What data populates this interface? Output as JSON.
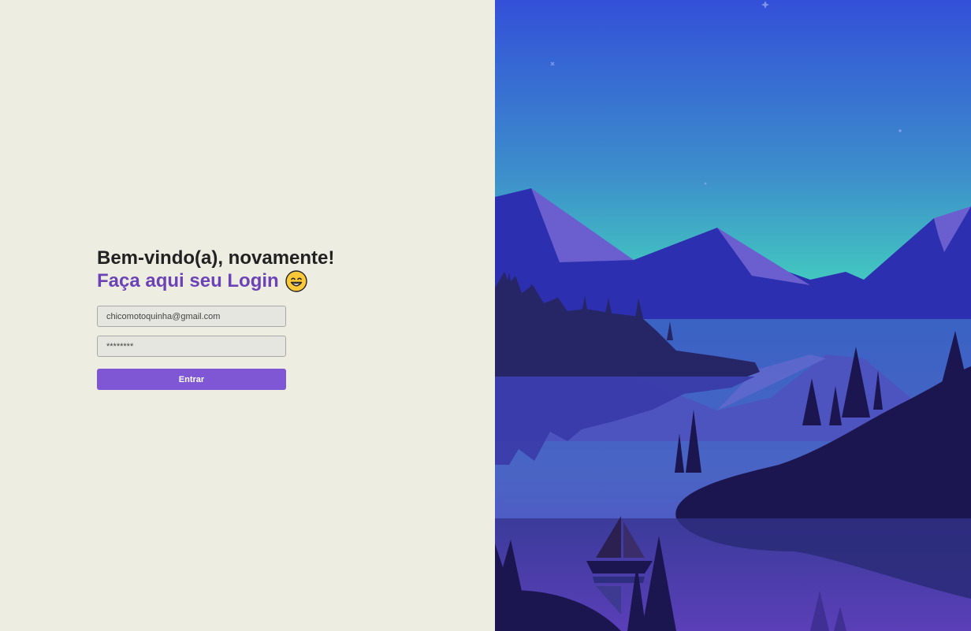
{
  "login": {
    "heading": "Bem-vindo(a), novamente!",
    "subheading": "Faça aqui seu Login",
    "emoji": "grinning-face-icon",
    "email_value": "chicomotoquinha@gmail.com",
    "password_value": "********",
    "submit_label": "Entrar"
  },
  "colors": {
    "background": "#eeede2",
    "heading": "#222222",
    "accent": "#6b43b5",
    "button": "#7f56d3",
    "sky_top": "#3350d8",
    "sky_bottom": "#44dcbb",
    "mountains": "#2c30b0",
    "forest": "#1c1650",
    "water": "#4f52bf"
  },
  "illustration": {
    "subject": "mountain-lake-landscape-illustration"
  }
}
